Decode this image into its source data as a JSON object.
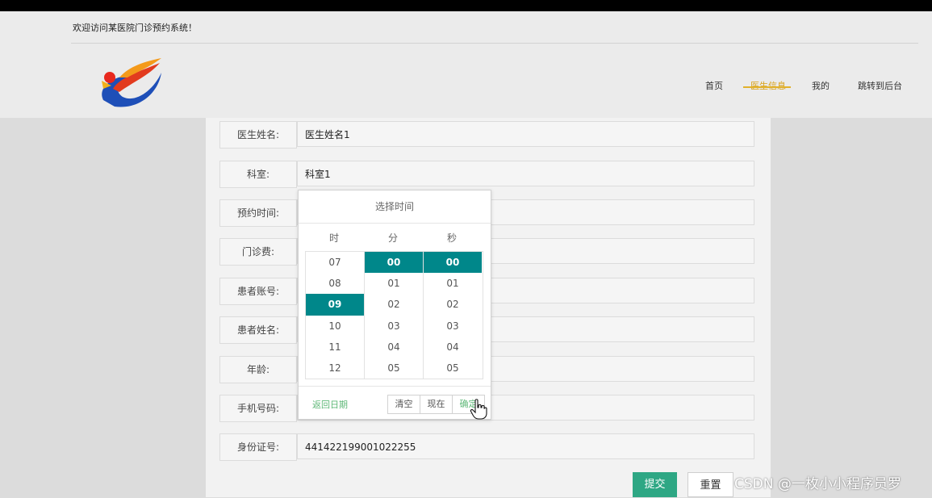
{
  "header": {
    "welcome": "欢迎访问某医院门诊预约系统！",
    "nav": [
      {
        "label": "首页"
      },
      {
        "label": "医生信息",
        "active": true
      },
      {
        "label": "我的"
      },
      {
        "label": "跳转到后台"
      }
    ]
  },
  "form": {
    "rows": [
      {
        "label": "医生姓名:",
        "value": "医生姓名1"
      },
      {
        "label": "科室:",
        "value": "科室1"
      },
      {
        "label": "预约时间:",
        "value": ""
      },
      {
        "label": "门诊费:",
        "value": ""
      },
      {
        "label": "患者账号:",
        "value": ""
      },
      {
        "label": "患者姓名:",
        "value": ""
      },
      {
        "label": "年龄:",
        "value": ""
      },
      {
        "label": "手机号码:",
        "value": ""
      },
      {
        "label": "身份证号:",
        "value": "441422199001022255"
      }
    ],
    "submit_label": "提交",
    "reset_label": "重置"
  },
  "time_picker": {
    "title": "选择时间",
    "columns": [
      "时",
      "分",
      "秒"
    ],
    "hours": [
      "07",
      "08",
      "09",
      "10",
      "11",
      "12"
    ],
    "minutes": [
      "00",
      "01",
      "02",
      "03",
      "04",
      "05"
    ],
    "seconds": [
      "00",
      "01",
      "02",
      "03",
      "04",
      "05"
    ],
    "selected_hour": "09",
    "selected_minute": "00",
    "selected_second": "00",
    "back_label": "返回日期",
    "clear_label": "清空",
    "now_label": "现在",
    "confirm_label": "确定"
  },
  "watermark": "CSDN @一枚小小程序员罗",
  "colors": {
    "accent": "#00878a",
    "submit": "#2ea784",
    "nav_active": "#d9a21a"
  }
}
